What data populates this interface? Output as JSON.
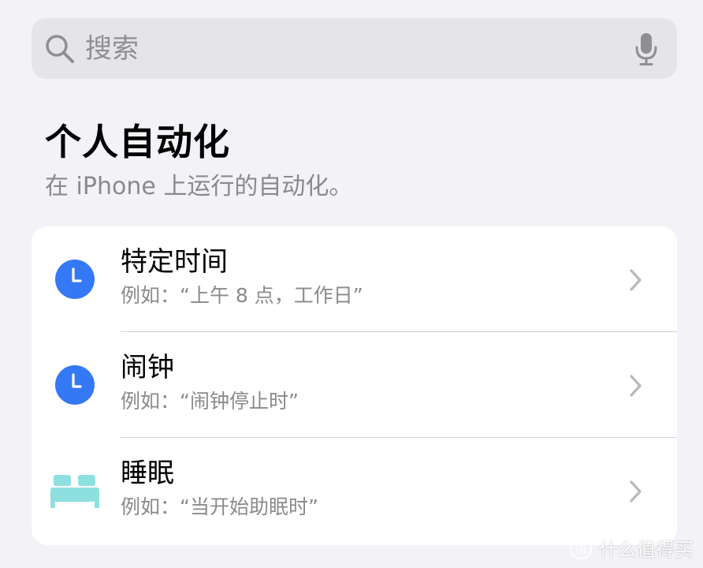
{
  "search": {
    "placeholder": "搜索",
    "search_icon": "search-icon",
    "mic_icon": "microphone-icon"
  },
  "section": {
    "title": "个人自动化",
    "subtitle": "在 iPhone 上运行的自动化。"
  },
  "list": {
    "items": [
      {
        "title": "特定时间",
        "subtitle": "例如：“上午 8 点，工作日”",
        "icon": "clock-icon",
        "icon_color": "#3478f6"
      },
      {
        "title": "闹钟",
        "subtitle": "例如：“闹钟停止时”",
        "icon": "clock-icon",
        "icon_color": "#3478f6"
      },
      {
        "title": "睡眠",
        "subtitle": "例如：“当开始助眠时”",
        "icon": "bed-icon",
        "icon_color": "#8ee0e0"
      }
    ],
    "chevron_icon": "chevron-right-icon"
  },
  "watermark": {
    "text": "什么值得买"
  },
  "colors": {
    "background": "#f2f2f7",
    "card": "#ffffff",
    "secondary_text": "#8a8a8e",
    "accent_blue": "#3478f6",
    "sleep_teal": "#8ee0e0"
  }
}
